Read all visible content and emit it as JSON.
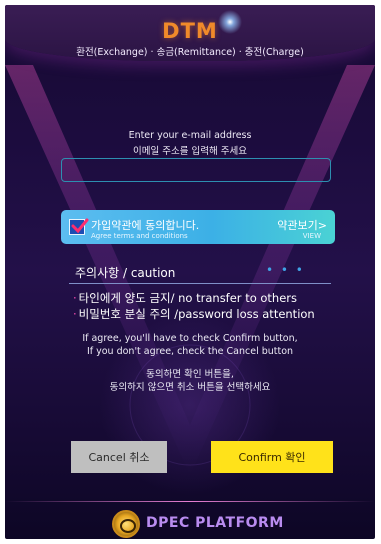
{
  "header": {
    "brand": "DTM",
    "subtitle": "환전(Exchange) · 송금(Remittance) · 충전(Charge)"
  },
  "form": {
    "prompt_en": "Enter your e-mail address",
    "prompt_ko": "이메일 주소를 입력해 주세요",
    "email_value": "",
    "email_placeholder": ""
  },
  "agreement": {
    "checked": true,
    "label_ko": "가입약관에 동의합니다.",
    "label_en": "Agree terms and conditions",
    "view_ko": "약관보기>",
    "view_en": "VIEW"
  },
  "caution": {
    "heading": "주의사항 / caution",
    "dots": "• • •",
    "rules": [
      {
        "bullet": "·",
        "text": "타인에게 양도 금지/ no transfer to others"
      },
      {
        "bullet": "·",
        "text": "비밀번호 분실 주의 /password loss attention"
      }
    ]
  },
  "info": {
    "en_line1": "If agree, you'll have to check Confirm button,",
    "en_line2": "If you don't agree, check the Cancel button",
    "ko_line1": "동의하면 확인 버튼을,",
    "ko_line2": "동의하지 않으면 취소 버튼을 선택하세요"
  },
  "buttons": {
    "cancel": "Cancel 취소",
    "confirm": "Confirm 확인"
  },
  "footer": {
    "platform": "DPEC PLATFORM"
  },
  "colors": {
    "confirm_bg": "#ffe21a",
    "cancel_bg": "#bfbfbf",
    "agree_bar": "#4ab8ea",
    "brand": "#f08a2a",
    "accent_dots": "#3fa3e6"
  }
}
